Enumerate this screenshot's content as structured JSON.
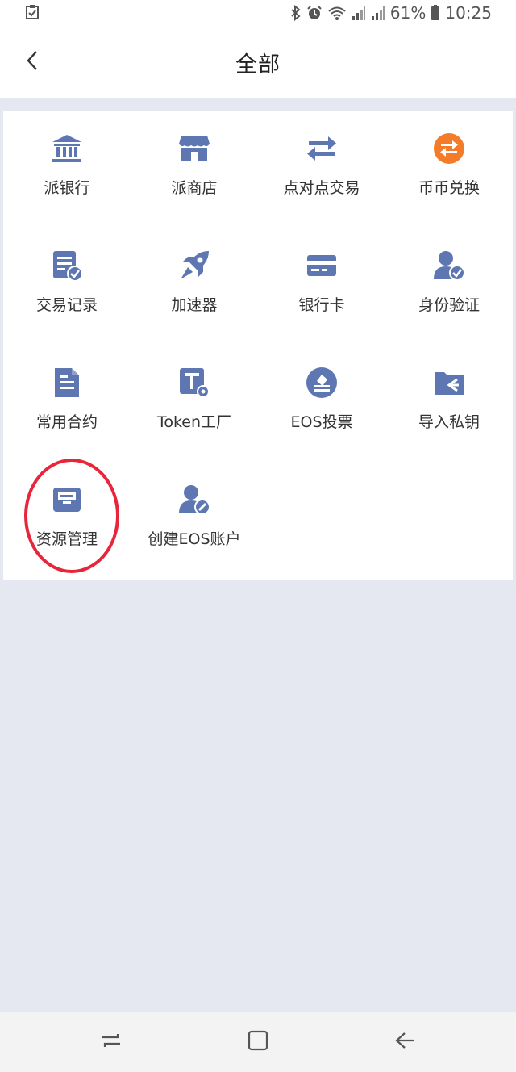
{
  "status_bar": {
    "battery": "61%",
    "time": "10:25",
    "icons": [
      "task-check-icon",
      "bluetooth-icon",
      "alarm-icon",
      "wifi-icon",
      "signal-icon",
      "signal-4g-icon",
      "battery-icon"
    ]
  },
  "header": {
    "title": "全部",
    "back_icon": "chevron-left-icon"
  },
  "colors": {
    "icon_blue": "#5e77b2",
    "accent_orange": "#f47b2a",
    "highlight_red": "#e8263b",
    "background": "#e5e8f1"
  },
  "grid": {
    "items": [
      {
        "label": "派银行",
        "icon": "bank-icon"
      },
      {
        "label": "派商店",
        "icon": "store-icon"
      },
      {
        "label": "点对点交易",
        "icon": "transfer-arrows-icon"
      },
      {
        "label": "币币兑换",
        "icon": "exchange-icon"
      },
      {
        "label": "交易记录",
        "icon": "transaction-record-icon"
      },
      {
        "label": "加速器",
        "icon": "rocket-icon"
      },
      {
        "label": "银行卡",
        "icon": "bank-card-icon"
      },
      {
        "label": "身份验证",
        "icon": "identity-verify-icon"
      },
      {
        "label": "常用合约",
        "icon": "contract-document-icon"
      },
      {
        "label": "Token工厂",
        "icon": "token-factory-icon"
      },
      {
        "label": "EOS投票",
        "icon": "vote-icon"
      },
      {
        "label": "导入私钥",
        "icon": "import-key-icon"
      },
      {
        "label": "资源管理",
        "icon": "resource-tray-icon"
      },
      {
        "label": "创建EOS账户",
        "icon": "create-account-icon"
      }
    ]
  },
  "nav_bar": {
    "buttons": [
      "recent-apps-icon",
      "home-icon",
      "back-arrow-icon"
    ]
  }
}
